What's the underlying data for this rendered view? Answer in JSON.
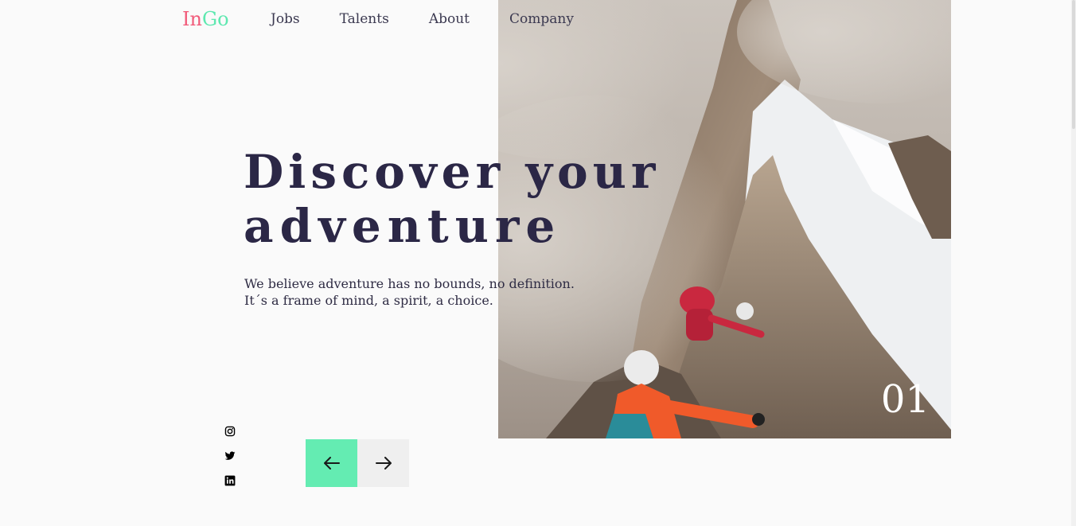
{
  "logo": {
    "part1": "In",
    "part2": "Go"
  },
  "nav": {
    "items": [
      "Jobs",
      "Talents",
      "About",
      "Company"
    ]
  },
  "hero": {
    "headline_bold": "Discover",
    "headline_rest_line1": " your",
    "headline_line2": "adventure",
    "sub_line1": "We believe adventure has no bounds, no definition.",
    "sub_line2": "It´s a frame of mind, a spirit, a choice.",
    "slide_number": "01"
  },
  "social": [
    "instagram-icon",
    "twitter-icon",
    "linkedin-icon"
  ],
  "controls": {
    "prev": "arrow-left-icon",
    "next": "arrow-right-icon"
  },
  "colors": {
    "accent": "#64ecb2",
    "brand_pink": "#f15b7a",
    "brand_green": "#5ee8b0",
    "text": "#2b2746"
  }
}
